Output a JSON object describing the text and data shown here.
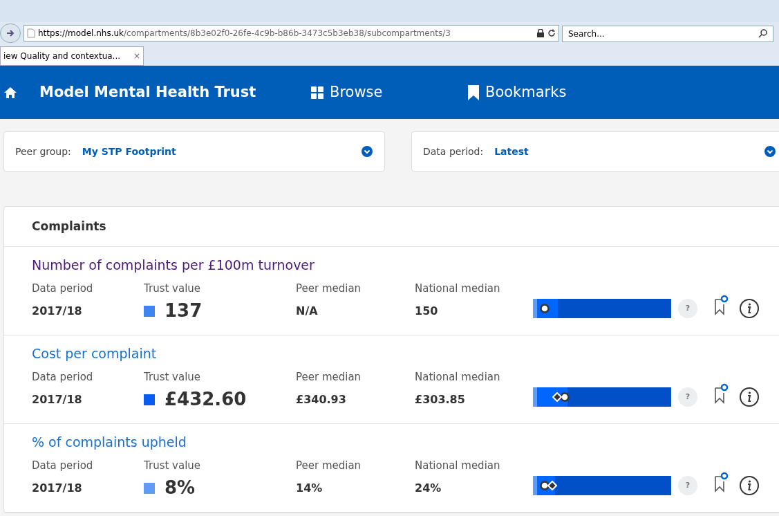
{
  "browser": {
    "url_host": "https://model.nhs.uk",
    "url_path": "/compartments/8b3e02f0-26fe-4c9b-b86b-3473c5b3eb38/subcompartments/3",
    "search": {
      "placeholder": "Search..."
    },
    "tab": {
      "label": "iew Quality and contextua...",
      "close": "×"
    }
  },
  "header": {
    "title": "Model Mental Health Trust",
    "nav": [
      {
        "label": "Browse",
        "kind": "grid"
      },
      {
        "label": "Bookmarks",
        "kind": "bookmark"
      }
    ]
  },
  "filters": [
    {
      "label": "Peer group:",
      "value": "My STP Footprint"
    },
    {
      "label": "Data period:",
      "value": "Latest"
    }
  ],
  "section": {
    "title": "Complaints",
    "metrics": [
      {
        "title": "Number of complaints per £100m turnover",
        "visited": true,
        "columns": [
          "Data period",
          "Trust value",
          "Peer median",
          "National median"
        ],
        "period": "2017/18",
        "trust_value": "137",
        "color": "#3d86f2",
        "peer_median": "N/A",
        "national_median": "150",
        "level": 0.06,
        "kind": "circle",
        "help": "?"
      },
      {
        "title": "Cost per complaint",
        "visited": false,
        "columns": [
          "Data period",
          "Trust value",
          "Peer median",
          "National median"
        ],
        "period": "2017/18",
        "trust_value": "£432.60",
        "color": "#0a5cf0",
        "peer_median": "£340.93",
        "national_median": "£303.85",
        "level": 0.15,
        "kind": "diamond_circle",
        "help": "?"
      },
      {
        "title": "% of complaints upheld",
        "visited": false,
        "columns": [
          "Data period",
          "Trust value",
          "Peer median",
          "National median"
        ],
        "period": "2017/18",
        "trust_value": "8%",
        "color": "#5e9cf5",
        "peer_median": "14%",
        "national_median": "24%",
        "level": 0.06,
        "kind": "circle_diamond",
        "help": "?"
      }
    ]
  }
}
